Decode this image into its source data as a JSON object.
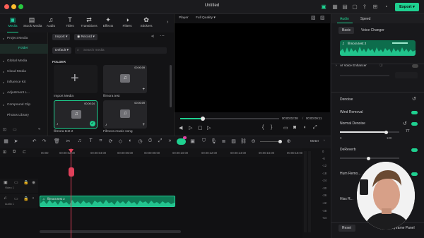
{
  "window": {
    "title": "Untitled",
    "export_label": "Export"
  },
  "media_tabs": [
    {
      "label": "Media",
      "icon": "media-icon",
      "active": true
    },
    {
      "label": "Stock Media",
      "icon": "stock-media-icon"
    },
    {
      "label": "Audio",
      "icon": "audio-icon"
    },
    {
      "label": "Titles",
      "icon": "titles-icon"
    },
    {
      "label": "Transitions",
      "icon": "transitions-icon"
    },
    {
      "label": "Effects",
      "icon": "effects-icon"
    },
    {
      "label": "Filters",
      "icon": "filters-icon"
    },
    {
      "label": "Stickers",
      "icon": "stickers-icon"
    }
  ],
  "sidebar": {
    "items": [
      {
        "label": "Project Media"
      },
      {
        "label": "Folder",
        "selected": true
      },
      {
        "label": "Global Media"
      },
      {
        "label": "Cloud Media"
      },
      {
        "label": "Influence Kit"
      },
      {
        "label": "Adjustment L..."
      },
      {
        "label": "Compound Clip"
      },
      {
        "label": "Photos Library"
      }
    ]
  },
  "media": {
    "import_label": "Import",
    "record_label": "Record",
    "default_label": "Default",
    "search_placeholder": "Search media",
    "folder_heading": "FOLDER",
    "items": [
      {
        "name": "Import Media",
        "duration": ""
      },
      {
        "name": "filmora test",
        "duration": "00:00:09"
      },
      {
        "name": "filmora test 2",
        "duration": "00:00:24"
      },
      {
        "name": "Filmora music song",
        "duration": "00:00:09"
      }
    ]
  },
  "player": {
    "label": "Player",
    "quality": "Full Quality",
    "current_time": "00:00:02:08",
    "total_time": "00:00:09:11",
    "progress": 0.23
  },
  "right_panel": {
    "tabs": [
      "Audio",
      "Speed"
    ],
    "subtabs": [
      "Basic",
      "Voice Changer"
    ],
    "clip_name": "filmora test 2",
    "voice_enhancer_label": "AI Voice Enhancer",
    "denoise_label": "Denoise",
    "wind_removal_label": "Wind Removal",
    "normal_denoise_label": "Normal Denoise",
    "normal_denoise_value": "77",
    "scale_min": "0",
    "scale_max": "100",
    "dereverb_label": "DeReverb",
    "hum_removal_label": "Hum Remo...",
    "hiss_label": "Hiss R...",
    "reset_label": "Reset",
    "keyframe_label": "Keyframe Panel"
  },
  "timeline": {
    "meter_label": "Meter",
    "ruler": [
      "00:00",
      "00:00:02:00",
      "00:00:04:00",
      "00:00:06:00",
      "00:00:08:00",
      "00:00:10:00",
      "00:00:12:00",
      "00:00:14:00",
      "00:00:16:00",
      "00:00:18:00"
    ],
    "video_track_label": "Video 1",
    "audio_track_label": "Audio 1",
    "audio_clip_label": "filmora test 2",
    "db_scale": [
      "0",
      "-6",
      "-12",
      "-18",
      "-24",
      "-30",
      "-36",
      "-42",
      "-48",
      "-54"
    ]
  },
  "colors": {
    "accent": "#1fd090",
    "playhead": "#e0405a"
  }
}
